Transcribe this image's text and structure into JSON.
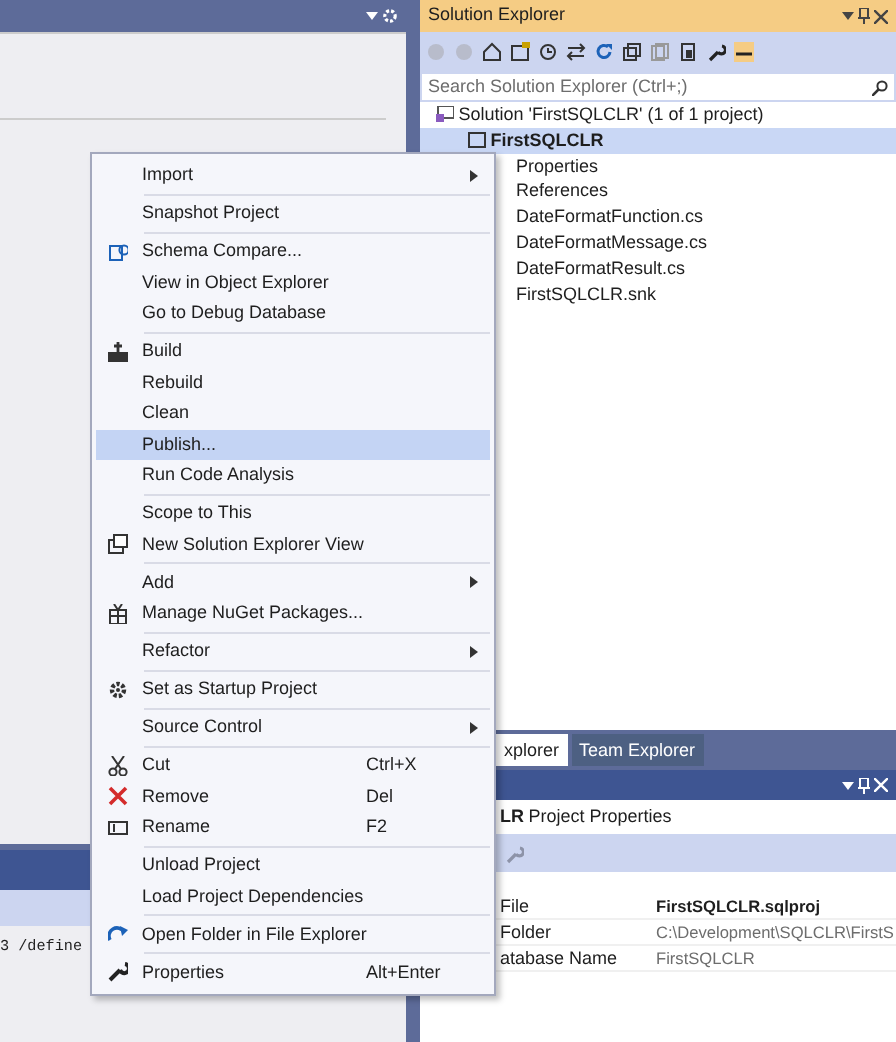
{
  "editor": {
    "output_text": "3 /define"
  },
  "solution_explorer": {
    "title": "Solution Explorer",
    "search": {
      "placeholder": "Search Solution Explorer (Ctrl+;)"
    },
    "tree": [
      {
        "label": "Solution 'FirstSQLCLR' (1 of 1 project)",
        "selected": false,
        "children": [
          {
            "label": "FirstSQLCLR",
            "selected": true,
            "children": [
              {
                "label": "Properties",
                "selected": false
              },
              {
                "label": "References",
                "selected": false
              },
              {
                "label": "DateFormatFunction.cs",
                "selected": false
              },
              {
                "label": "DateFormatMessage.cs",
                "selected": false
              },
              {
                "label": "DateFormatResult.cs",
                "selected": false
              },
              {
                "label": "FirstSQLCLR.snk",
                "selected": false
              }
            ]
          }
        ]
      }
    ]
  },
  "tabs": [
    {
      "label": "xplorer",
      "selected": true
    },
    {
      "label": "Team Explorer",
      "selected": false
    }
  ],
  "properties": {
    "header_bold": "LR",
    "header": "Project Properties",
    "rows": [
      {
        "name": "File",
        "value": "FirstSQLCLR.sqlproj",
        "bold": true
      },
      {
        "name": "Folder",
        "value": "C:\\Development\\SQLCLR\\FirstS",
        "bold": false
      },
      {
        "name": "atabase Name",
        "value": "FirstSQLCLR",
        "bold": false
      }
    ]
  },
  "context_menu": [
    {
      "kind": "item",
      "label": "Import",
      "submenu": true,
      "selected": false
    },
    {
      "kind": "separator"
    },
    {
      "kind": "item",
      "label": "Snapshot Project",
      "submenu": false,
      "selected": false
    },
    {
      "kind": "separator"
    },
    {
      "kind": "item",
      "label": "Schema Compare...",
      "submenu": false,
      "selected": false
    },
    {
      "kind": "item",
      "label": "View in Object Explorer",
      "submenu": false,
      "selected": false
    },
    {
      "kind": "item",
      "label": "Go to Debug Database",
      "submenu": false,
      "selected": false
    },
    {
      "kind": "separator"
    },
    {
      "kind": "item",
      "label": "Build",
      "submenu": false,
      "selected": false
    },
    {
      "kind": "item",
      "label": "Rebuild",
      "submenu": false,
      "selected": false
    },
    {
      "kind": "item",
      "label": "Clean",
      "submenu": false,
      "selected": false
    },
    {
      "kind": "item",
      "label": "Publish...",
      "submenu": false,
      "selected": true
    },
    {
      "kind": "item",
      "label": "Run Code Analysis",
      "submenu": false,
      "selected": false
    },
    {
      "kind": "separator"
    },
    {
      "kind": "item",
      "label": "Scope to This",
      "submenu": false,
      "selected": false
    },
    {
      "kind": "item",
      "label": "New Solution Explorer View",
      "submenu": false,
      "selected": false
    },
    {
      "kind": "separator"
    },
    {
      "kind": "item",
      "label": "Add",
      "submenu": true,
      "selected": false
    },
    {
      "kind": "item",
      "label": "Manage NuGet Packages...",
      "submenu": false,
      "selected": false
    },
    {
      "kind": "separator"
    },
    {
      "kind": "item",
      "label": "Refactor",
      "submenu": true,
      "selected": false
    },
    {
      "kind": "separator"
    },
    {
      "kind": "item",
      "label": "Set as Startup Project",
      "submenu": false,
      "selected": false
    },
    {
      "kind": "separator"
    },
    {
      "kind": "item",
      "label": "Source Control",
      "submenu": true,
      "selected": false
    },
    {
      "kind": "separator"
    },
    {
      "kind": "item",
      "label": "Cut",
      "shortcut": "Ctrl+X",
      "submenu": false,
      "selected": false
    },
    {
      "kind": "item",
      "label": "Remove",
      "shortcut": "Del",
      "submenu": false,
      "selected": false
    },
    {
      "kind": "item",
      "label": "Rename",
      "shortcut": "F2",
      "submenu": false,
      "selected": false
    },
    {
      "kind": "separator"
    },
    {
      "kind": "item",
      "label": "Unload Project",
      "submenu": false,
      "selected": false
    },
    {
      "kind": "item",
      "label": "Load Project Dependencies",
      "submenu": false,
      "selected": false
    },
    {
      "kind": "separator"
    },
    {
      "kind": "item",
      "label": "Open Folder in File Explorer",
      "submenu": false,
      "selected": false
    },
    {
      "kind": "separator"
    },
    {
      "kind": "item",
      "label": "Properties",
      "shortcut": "Alt+Enter",
      "submenu": false,
      "selected": false
    }
  ]
}
